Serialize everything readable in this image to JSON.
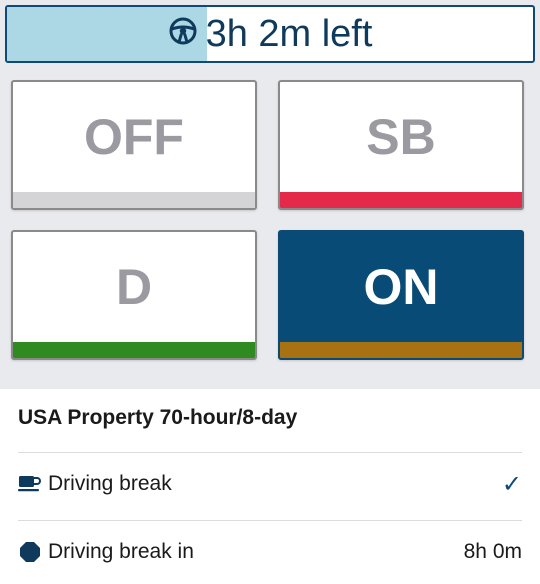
{
  "timer": {
    "text": "3h 2m left",
    "progress_fraction": 0.38,
    "icon": "steering-wheel-icon"
  },
  "status_buttons": [
    {
      "label": "OFF",
      "bar_color": "#d4d4d6",
      "active": false
    },
    {
      "label": "SB",
      "bar_color": "#e5294a",
      "active": false
    },
    {
      "label": "D",
      "bar_color": "#2f8a1f",
      "active": false
    },
    {
      "label": "ON",
      "bar_color": "#a87112",
      "active": true
    }
  ],
  "ruleset": "USA Property 70-hour/8-day",
  "rows": [
    {
      "label": "Driving break",
      "icon": "coffee-cup-icon",
      "value": "✓"
    },
    {
      "label": "Driving break in",
      "icon": "octagon-stop-icon",
      "value": "8h 0m"
    }
  ],
  "colors": {
    "accent": "#0f4a77",
    "timer_fill": "#acd8e6",
    "background_top": "#e9eaee"
  }
}
